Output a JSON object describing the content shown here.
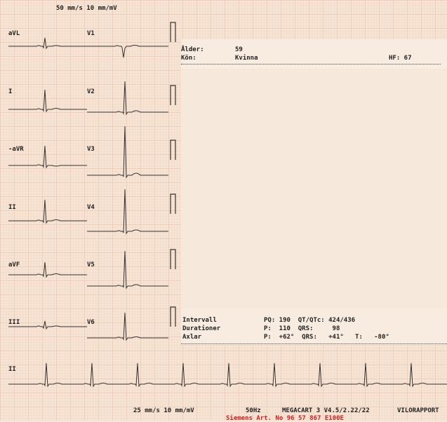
{
  "header": {
    "speed_top": "50 mm/s 10 mm/mV"
  },
  "patient": {
    "age_label": "Ålder:",
    "age_value": "59",
    "sex_label": "Kön:",
    "sex_value": "Kvinna",
    "hr_label": "HF: 67"
  },
  "leads": {
    "avl": "aVL",
    "i": "I",
    "avr": "-aVR",
    "ii": "II",
    "avf": "aVF",
    "iii": "III",
    "v1": "V1",
    "v2": "V2",
    "v3": "V3",
    "v4": "V4",
    "v5": "V5",
    "v6": "V6",
    "rhythm": "II"
  },
  "measurements": {
    "intervall_label": "Intervall",
    "durationer_label": "Durationer",
    "axlar_label": "Axlar",
    "row1": "PQ: 190  QT/QTc: 424/436",
    "row2": "P:  110  QRS:     98",
    "row3": "P:  +62°  QRS:   +41°   T:   -80°"
  },
  "footer": {
    "speed_bottom": "25 mm/s 10 mm/mV",
    "filter": "50Hz",
    "device": "MEGACART 3 V4.5/2.22/22",
    "report": "VILORAPPORT",
    "serial": "Siemens Art. No 96 57 867 E100E"
  }
}
